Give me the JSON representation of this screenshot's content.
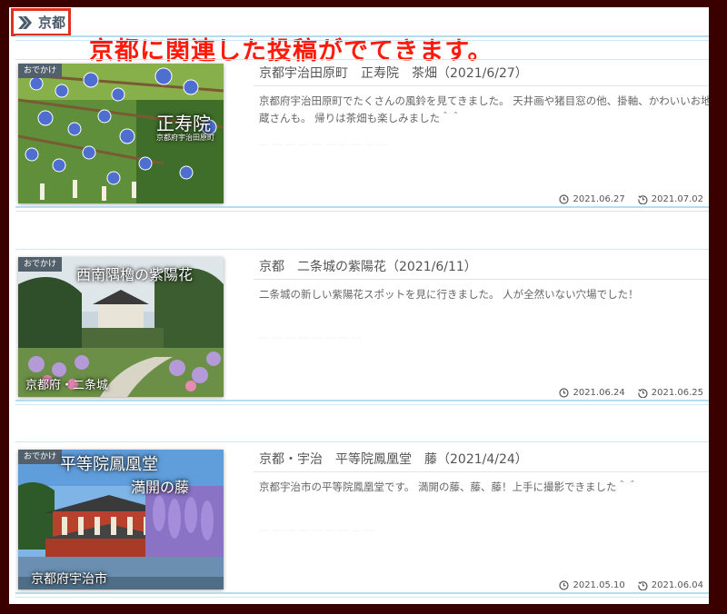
{
  "breadcrumb": {
    "label": "京都",
    "icon": "double-chevron-icon"
  },
  "annotation": "京都に関連した投稿がでてきます。",
  "posts": [
    {
      "category": "おでかけ",
      "title": "京都宇治田原町　正寿院　茶畑（2021/6/27）",
      "excerpt": "京都府宇治田原町でたくさんの風鈴を見てきました。 天井画や猪目窓の他、掛軸、かわいいお地蔵さんも。 帰りは茶畑も楽しみました＾＾",
      "ghost": "― ― ― ― ― ― ― ― ― ―",
      "thumb_overlay": [
        "正寿院",
        "京都府宇治田原町"
      ],
      "published": "2021.06.27",
      "updated": "2021.07.02"
    },
    {
      "category": "おでかけ",
      "title": "京都　二条城の紫陽花（2021/6/11）",
      "excerpt": "二条城の新しい紫陽花スポットを見に行きました。 人が全然いない穴場でした！",
      "ghost": "― ― ― ― ― ― ― ―",
      "thumb_overlay": [
        "西南隅櫓の紫陽花",
        "京都府・二条城"
      ],
      "published": "2021.06.24",
      "updated": "2021.06.25"
    },
    {
      "category": "おでかけ",
      "title": "京都・宇治　平等院鳳凰堂　藤（2021/4/24）",
      "excerpt": "京都宇治市の平等院鳳凰堂です。 満開の藤、藤、藤！上手に撮影できました＾＾",
      "ghost": "― ― ― ― ― ― ― ― ―",
      "thumb_overlay": [
        "平等院鳳凰堂",
        "満開の藤",
        "京都府宇治市"
      ],
      "published": "2021.05.10",
      "updated": "2021.06.04"
    }
  ]
}
